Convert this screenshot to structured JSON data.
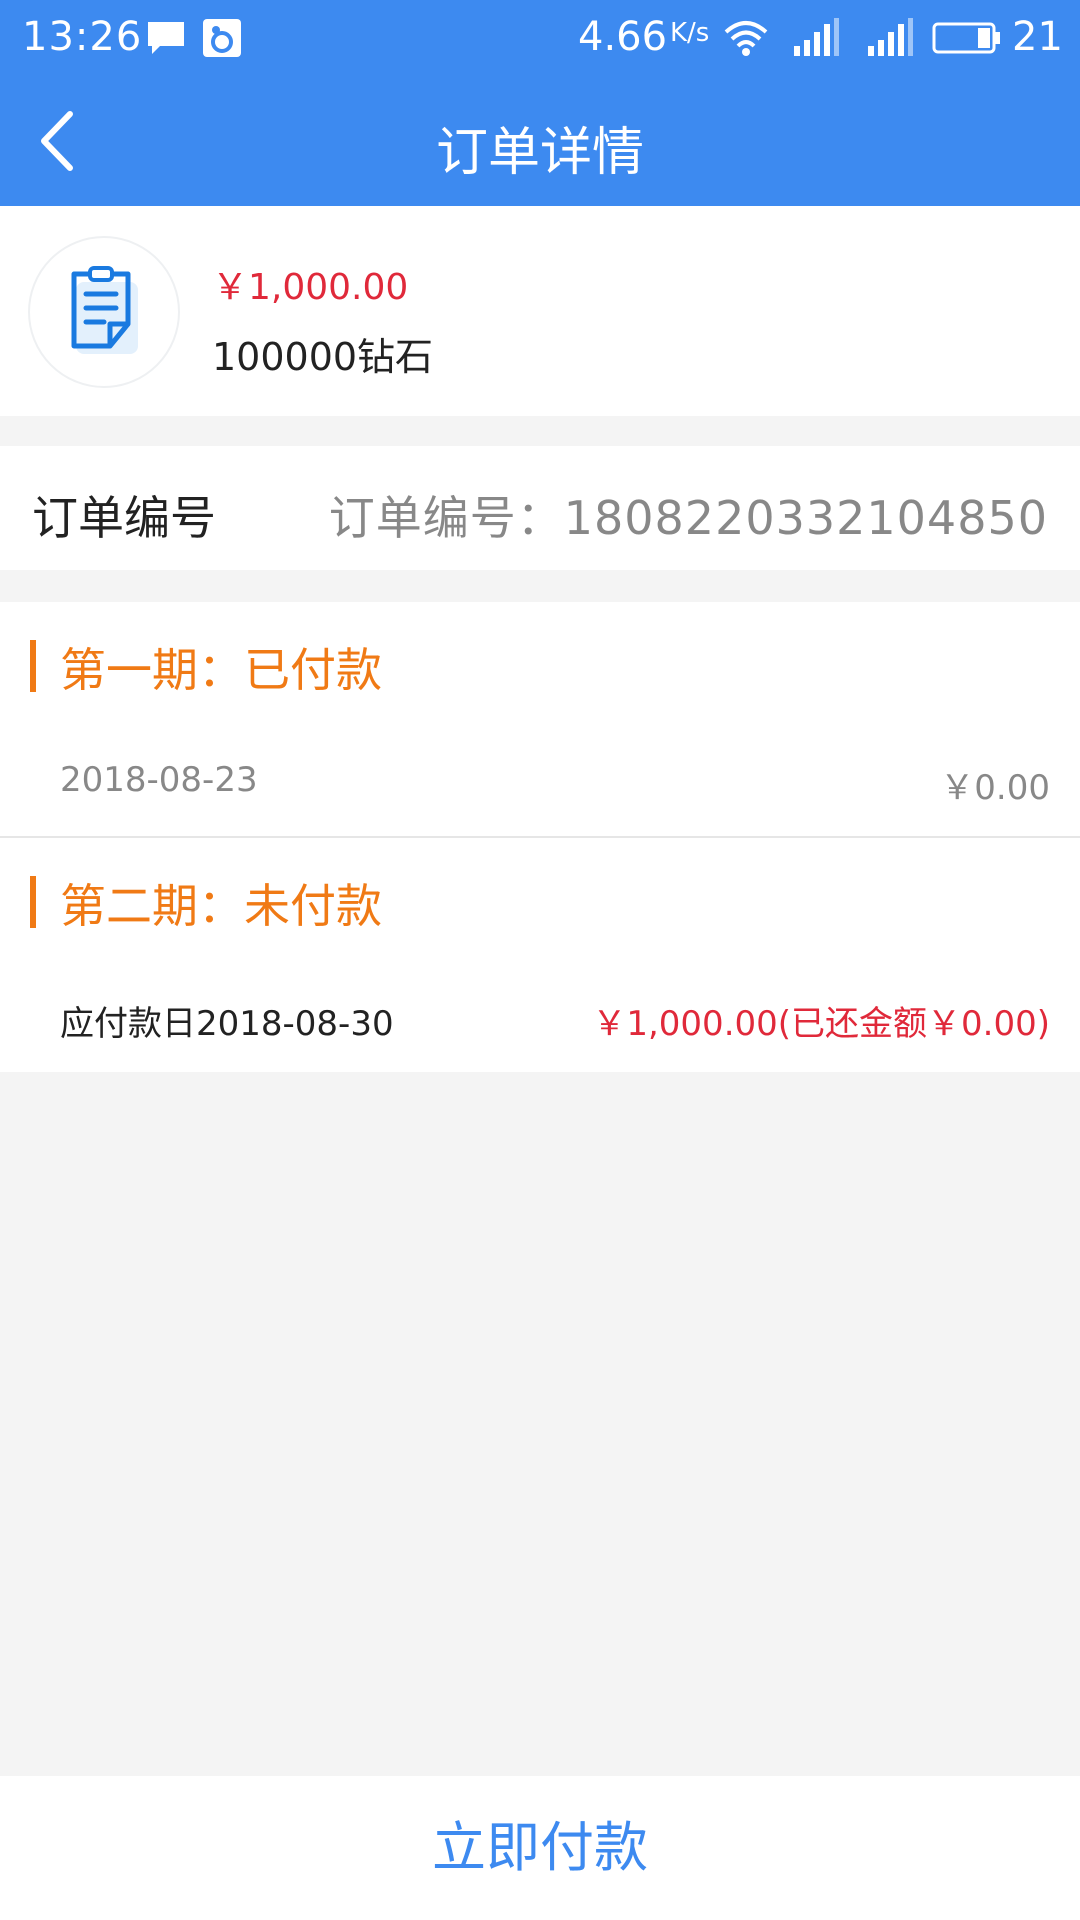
{
  "status_bar": {
    "time": "13:26",
    "net_speed": "4.66",
    "net_speed_unit": "K/s",
    "battery": "21"
  },
  "header": {
    "title": "订单详情",
    "back_icon": "chevron-left-icon"
  },
  "product": {
    "icon": "document-icon",
    "price": "￥1,000.00",
    "name": "100000钻石"
  },
  "order": {
    "label": "订单编号",
    "value": "订单编号：1808220332104850"
  },
  "installments": [
    {
      "title": "第一期：已付款",
      "date": "2018-08-23",
      "amount": "￥0.00"
    },
    {
      "title": "第二期：未付款",
      "date": "应付款日2018-08-30",
      "amount": "￥1,000.00(已还金额￥0.00)"
    }
  ],
  "footer": {
    "pay_label": "立即付款"
  },
  "colors": {
    "primary": "#3d8af0",
    "accent_orange": "#f07a15",
    "price_red": "#e0293a",
    "background": "#f4f4f4"
  }
}
